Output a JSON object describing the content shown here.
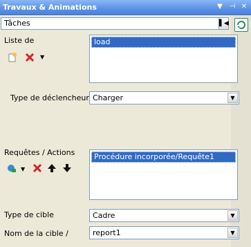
{
  "window": {
    "title": "Travaux & Animations"
  },
  "top_combo": {
    "value": "Tâches"
  },
  "section1": {
    "label": "Liste de",
    "list_items": [
      "load"
    ],
    "trigger_label": "Type de déclencheur",
    "trigger_value": "Charger"
  },
  "section2": {
    "label": "Requêtes / Actions",
    "list_items": [
      "Procédure incorporée/Requête1"
    ],
    "target_type_label": "Type de cible",
    "target_type_value": "Cadre",
    "target_name_label": "Nom de la cible /",
    "target_name_value": "report1"
  },
  "colors": {
    "title_bar": "#5b92e6",
    "selection": "#316ac5"
  }
}
